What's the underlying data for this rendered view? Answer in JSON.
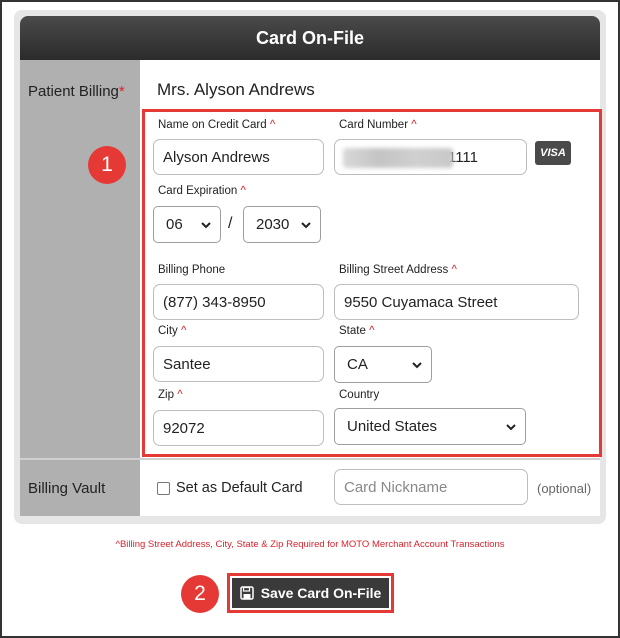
{
  "form": {
    "title": "Card On-File",
    "patient_billing_label": "Patient Billing",
    "required_mark": "*",
    "patient_name": "Mrs. Alyson Andrews",
    "billing_vault_label": "Billing Vault"
  },
  "fields": {
    "name_on_card_label": "Name on Credit Card",
    "name_on_card_value": "Alyson Andrews",
    "card_number_label": "Card Number",
    "card_number_last4": "1111",
    "card_brand": "VISA",
    "card_expiration_label": "Card Expiration",
    "exp_month": "06",
    "exp_separator": "/",
    "exp_year": "2030",
    "billing_phone_label": "Billing Phone",
    "billing_phone_value": "(877) 343-8950",
    "billing_street_label": "Billing Street Address",
    "billing_street_value": "9550 Cuyamaca Street",
    "city_label": "City",
    "city_value": "Santee",
    "state_label": "State",
    "state_value": "CA",
    "zip_label": "Zip",
    "zip_value": "92072",
    "country_label": "Country",
    "country_value": "United States",
    "required_caret": "^"
  },
  "vault": {
    "default_card_label": "Set as Default Card",
    "default_card_checked": false,
    "nickname_placeholder": "Card Nickname",
    "optional_label": "(optional)"
  },
  "footnote": "^Billing Street Address, City, State & Zip Required for MOTO Merchant Account Transactions",
  "actions": {
    "save_label": "Save Card On-File"
  },
  "markers": {
    "marker_1": "1",
    "marker_2": "2"
  },
  "colors": {
    "accent_red": "#e53935",
    "header_dark": "#2b2b2b",
    "sidebar_gray": "#b0b0b0"
  }
}
